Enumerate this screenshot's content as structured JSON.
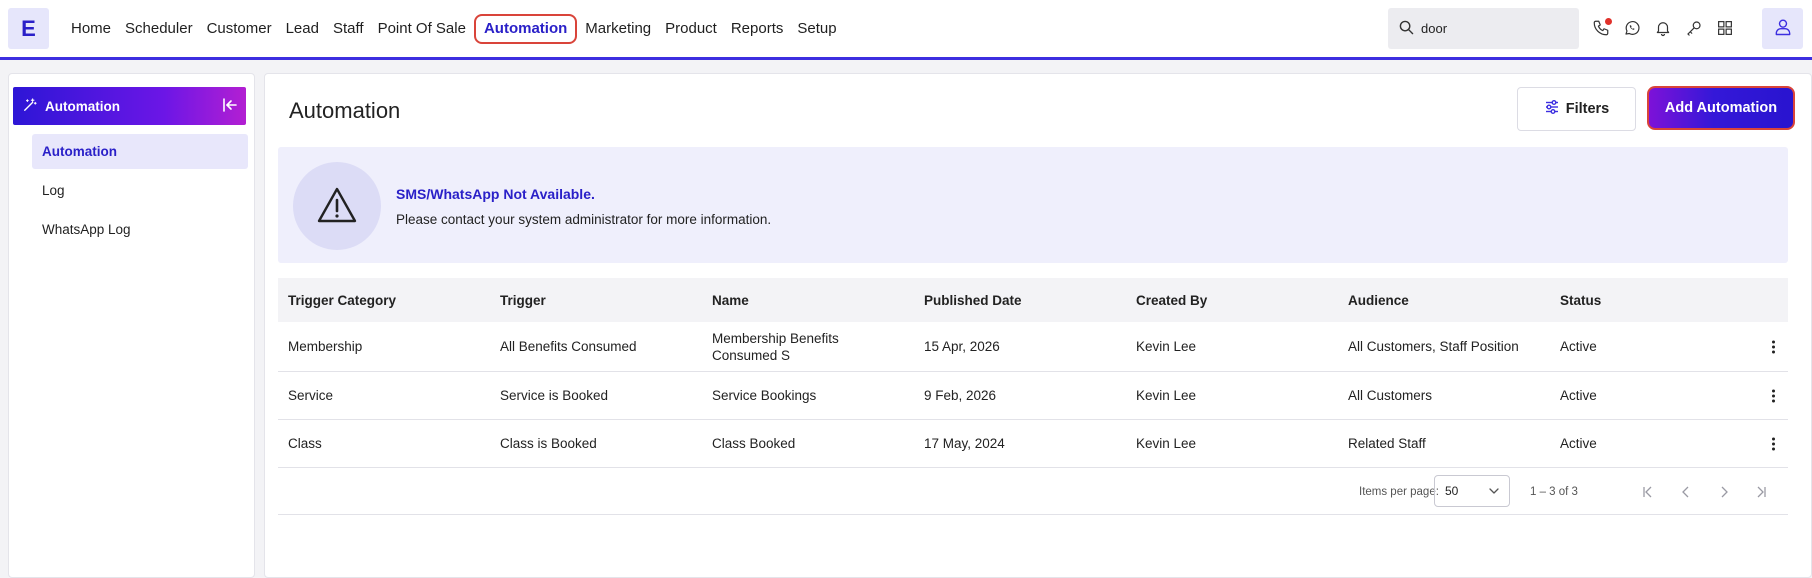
{
  "app": {
    "logo_letter": "E"
  },
  "nav": {
    "items": [
      "Home",
      "Scheduler",
      "Customer",
      "Lead",
      "Staff",
      "Point Of Sale",
      "Automation",
      "Marketing",
      "Product",
      "Reports",
      "Setup"
    ],
    "active": "Automation"
  },
  "search": {
    "value": "door"
  },
  "top_icons": [
    "phone-icon",
    "whatsapp-icon",
    "bell-icon",
    "key-icon",
    "grid-icon"
  ],
  "sidebar": {
    "header": "Automation",
    "items": [
      {
        "label": "Automation",
        "active": true
      },
      {
        "label": "Log",
        "active": false
      },
      {
        "label": "WhatsApp Log",
        "active": false
      }
    ]
  },
  "main": {
    "title": "Automation",
    "filters_label": "Filters",
    "add_label": "Add Automation"
  },
  "alert": {
    "title": "SMS/WhatsApp Not Available.",
    "text": "Please contact your system administrator for more information."
  },
  "table": {
    "headers": [
      "Trigger Category",
      "Trigger",
      "Name",
      "Published Date",
      "Created By",
      "Audience",
      "Status"
    ],
    "rows": [
      [
        "Membership",
        "All Benefits Consumed",
        "Membership Benefits Consumed S",
        "15 Apr, 2026",
        "Kevin Lee",
        "All Customers, Staff Position",
        "Active"
      ],
      [
        "Service",
        "Service is Booked",
        "Service Bookings",
        "9 Feb, 2026",
        "Kevin Lee",
        "All Customers",
        "Active"
      ],
      [
        "Class",
        "Class is Booked",
        "Class Booked",
        "17 May, 2024",
        "Kevin Lee",
        "Related Staff",
        "Active"
      ]
    ]
  },
  "pagination": {
    "items_per_page_label": "Items per page:",
    "items_per_page": "50",
    "range": "1 – 3 of 3"
  },
  "colors": {
    "accent": "#2a20c8",
    "highlight": "#d9443a"
  }
}
